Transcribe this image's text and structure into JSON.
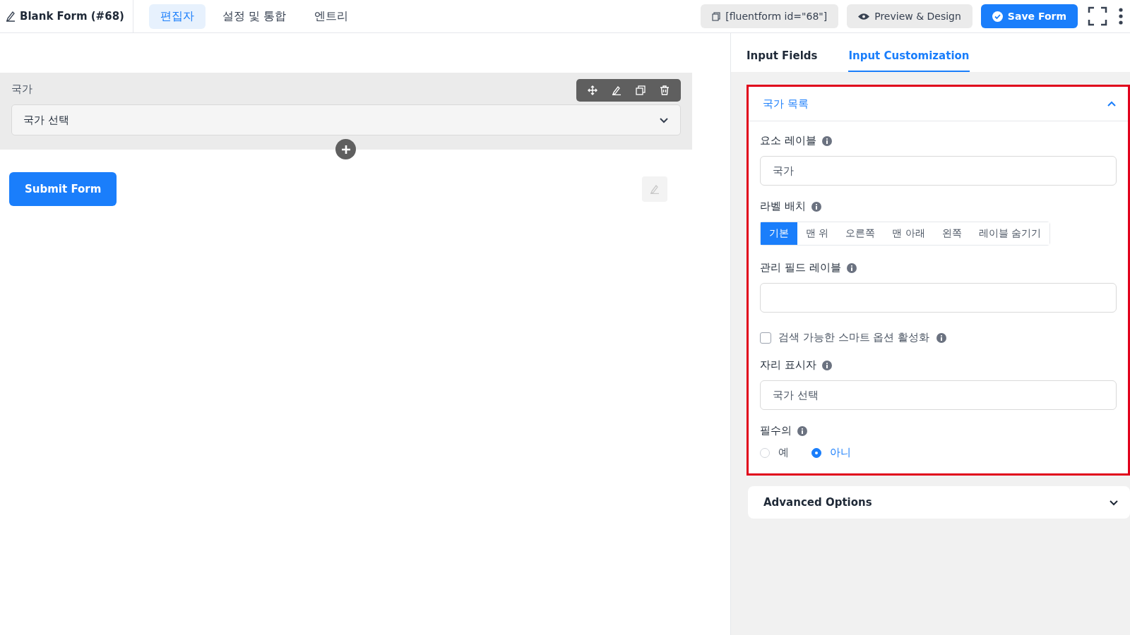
{
  "header": {
    "title": "Blank Form (#68)",
    "tabs": [
      {
        "label": "편집자",
        "selected": true
      },
      {
        "label": "설정 및 통합",
        "selected": false
      },
      {
        "label": "엔트리",
        "selected": false
      }
    ],
    "shortcode": "[fluentform id=\"68\"]",
    "preview": "Preview & Design",
    "save": "Save Form"
  },
  "canvas": {
    "field": {
      "label": "국가",
      "placeholder": "국가 선택"
    },
    "submit": "Submit Form"
  },
  "sidebar": {
    "tabs": [
      {
        "label": "Input Fields",
        "selected": false
      },
      {
        "label": "Input Customization",
        "selected": true
      }
    ],
    "section": {
      "title": "국가 목록",
      "expanded": true,
      "settings": [
        {
          "kind": "text",
          "label": "요소 레이블",
          "value": "국가"
        },
        {
          "kind": "segmented",
          "label": "라벨 배치",
          "options": [
            {
              "label": "기본",
              "selected": true
            },
            {
              "label": "맨 위",
              "selected": false
            },
            {
              "label": "오른쪽",
              "selected": false
            },
            {
              "label": "맨 아래",
              "selected": false
            },
            {
              "label": "왼쪽",
              "selected": false
            },
            {
              "label": "레이블 숨기기",
              "selected": false
            }
          ]
        },
        {
          "kind": "text",
          "label": "관리 필드 레이블"
        },
        {
          "kind": "checkbox",
          "label": "검색 가능한 스마트 옵션 활성화",
          "checked": false
        },
        {
          "kind": "text",
          "label": "자리 표시자",
          "value": "국가 선택"
        },
        {
          "kind": "radio",
          "label": "필수의",
          "options": [
            {
              "label": "예",
              "selected": false
            },
            {
              "label": "아니",
              "selected": true
            }
          ]
        }
      ]
    },
    "advanced": {
      "title": "Advanced Options",
      "expanded": false
    }
  }
}
